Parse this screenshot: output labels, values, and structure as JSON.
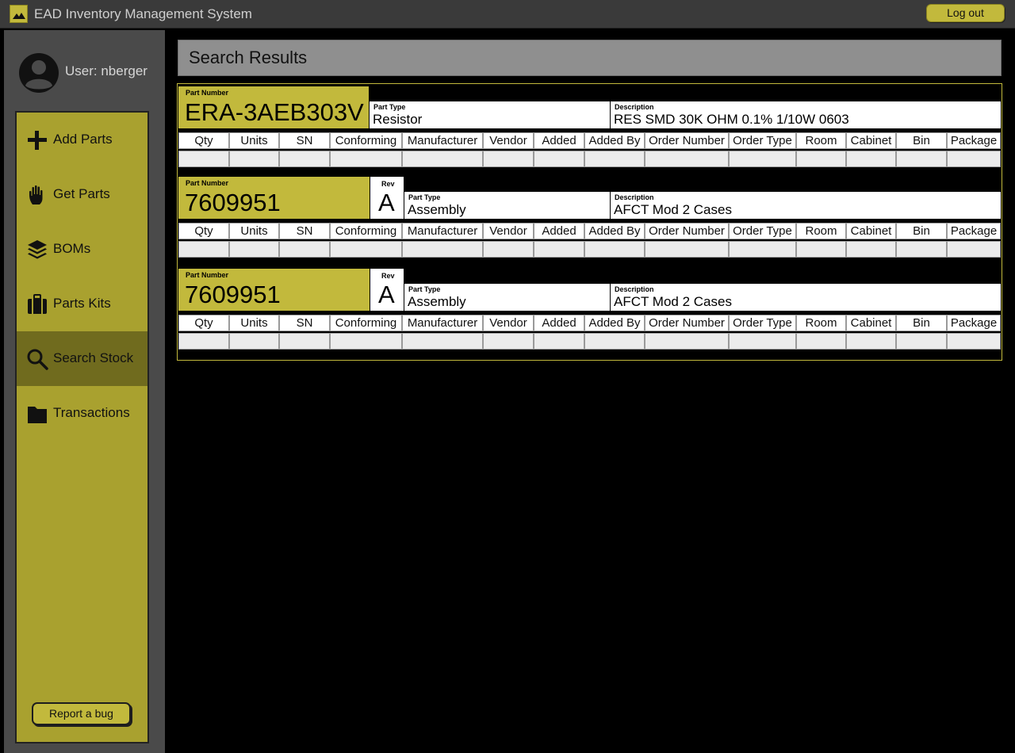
{
  "app": {
    "title": "EAD Inventory Management System",
    "logout_label": "Log out"
  },
  "user": {
    "label": "User: nberger"
  },
  "nav": {
    "items": [
      {
        "label": "Add Parts",
        "icon": "plus-icon"
      },
      {
        "label": "Get Parts",
        "icon": "hand-icon"
      },
      {
        "label": "BOMs",
        "icon": "layers-icon"
      },
      {
        "label": "Parts Kits",
        "icon": "briefcase-icon"
      },
      {
        "label": "Search Stock",
        "icon": "search-icon",
        "active": true
      },
      {
        "label": "Transactions",
        "icon": "folder-icon"
      }
    ],
    "bug_label": "Report a bug"
  },
  "page": {
    "title": "Search Results"
  },
  "columns": [
    "Qty",
    "Units",
    "SN",
    "Conforming",
    "Manufacturer",
    "Vendor",
    "Added",
    "Added By",
    "Order Number",
    "Order Type",
    "Room",
    "Cabinet",
    "Bin",
    "Package"
  ],
  "results": [
    {
      "part_number_caption": "Part Number",
      "part_number": "ERA-3AEB303V",
      "part_type_caption": "Part Type",
      "part_type": "Resistor",
      "description_caption": "Description",
      "description": "RES SMD 30K OHM 0.1% 1/10W 0603"
    },
    {
      "part_number_caption": "Part Number",
      "part_number": "7609951",
      "rev_caption": "Rev",
      "rev": "A",
      "part_type_caption": "Part Type",
      "part_type": "Assembly",
      "description_caption": "Description",
      "description": "AFCT Mod 2 Cases"
    },
    {
      "part_number_caption": "Part Number",
      "part_number": "7609951",
      "rev_caption": "Rev",
      "rev": "A",
      "part_type_caption": "Part Type",
      "part_type": "Assembly",
      "description_caption": "Description",
      "description": "AFCT Mod 2 Cases"
    }
  ],
  "colors": {
    "accent": "#c2b93c",
    "nav_bg": "#a9a12f",
    "nav_active": "#706b1e",
    "header_bg": "#8f8f8f"
  }
}
